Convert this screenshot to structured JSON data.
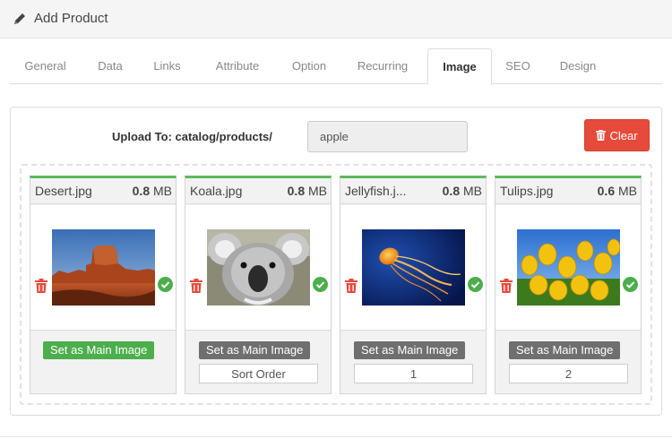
{
  "header": {
    "title": "Add Product",
    "icon": "pencil-icon"
  },
  "tabs": [
    {
      "label": "General",
      "active": false
    },
    {
      "label": "Data",
      "active": false
    },
    {
      "label": "Links",
      "active": false
    },
    {
      "label": "Attribute",
      "active": false
    },
    {
      "label": "Option",
      "active": false
    },
    {
      "label": "Recurring",
      "active": false
    },
    {
      "label": "Image",
      "active": true
    },
    {
      "label": "SEO",
      "active": false
    },
    {
      "label": "Design",
      "active": false
    }
  ],
  "upload": {
    "label": "Upload To: catalog/products/",
    "folder_value": "apple",
    "clear_label": "Clear",
    "clear_icon": "trash-icon"
  },
  "colors": {
    "success": "#5cb85c",
    "danger": "#e64a3b",
    "muted_button": "#6f6f6f"
  },
  "images": [
    {
      "filename": "Desert.jpg",
      "size_value": "0.8",
      "size_unit": "MB",
      "main_label": "Set as Main Image",
      "is_main": true,
      "sort_placeholder": "",
      "sort_value": ""
    },
    {
      "filename": "Koala.jpg",
      "size_value": "0.8",
      "size_unit": "MB",
      "main_label": "Set as Main Image",
      "is_main": false,
      "sort_placeholder": "Sort Order",
      "sort_value": ""
    },
    {
      "filename": "Jellyfish.j...",
      "size_value": "0.8",
      "size_unit": "MB",
      "main_label": "Set as Main Image",
      "is_main": false,
      "sort_placeholder": "",
      "sort_value": "1"
    },
    {
      "filename": "Tulips.jpg",
      "size_value": "0.6",
      "size_unit": "MB",
      "main_label": "Set as Main Image",
      "is_main": false,
      "sort_placeholder": "",
      "sort_value": "2"
    }
  ]
}
